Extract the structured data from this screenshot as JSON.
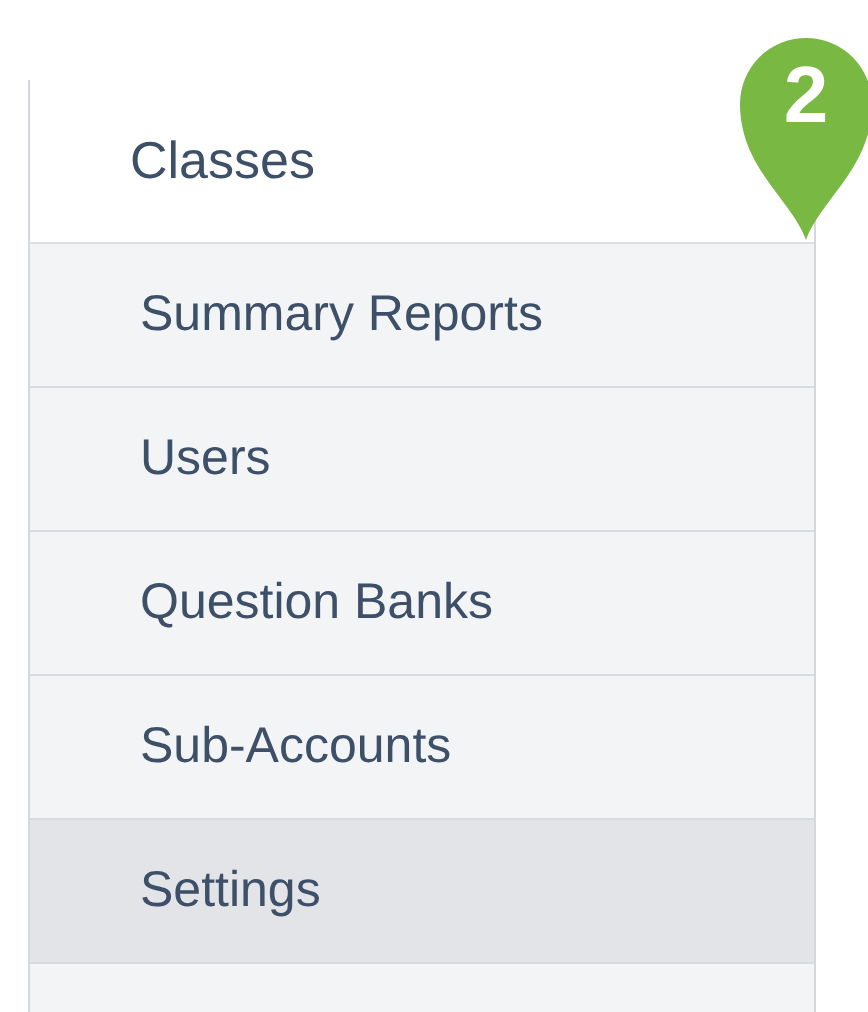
{
  "header": {
    "title": "Classes"
  },
  "items": [
    {
      "label": "Summary Reports",
      "selected": false
    },
    {
      "label": "Users",
      "selected": false
    },
    {
      "label": "Question Banks",
      "selected": false
    },
    {
      "label": "Sub-Accounts",
      "selected": false
    },
    {
      "label": "Settings",
      "selected": true
    }
  ],
  "step_badge": {
    "number": "2"
  }
}
